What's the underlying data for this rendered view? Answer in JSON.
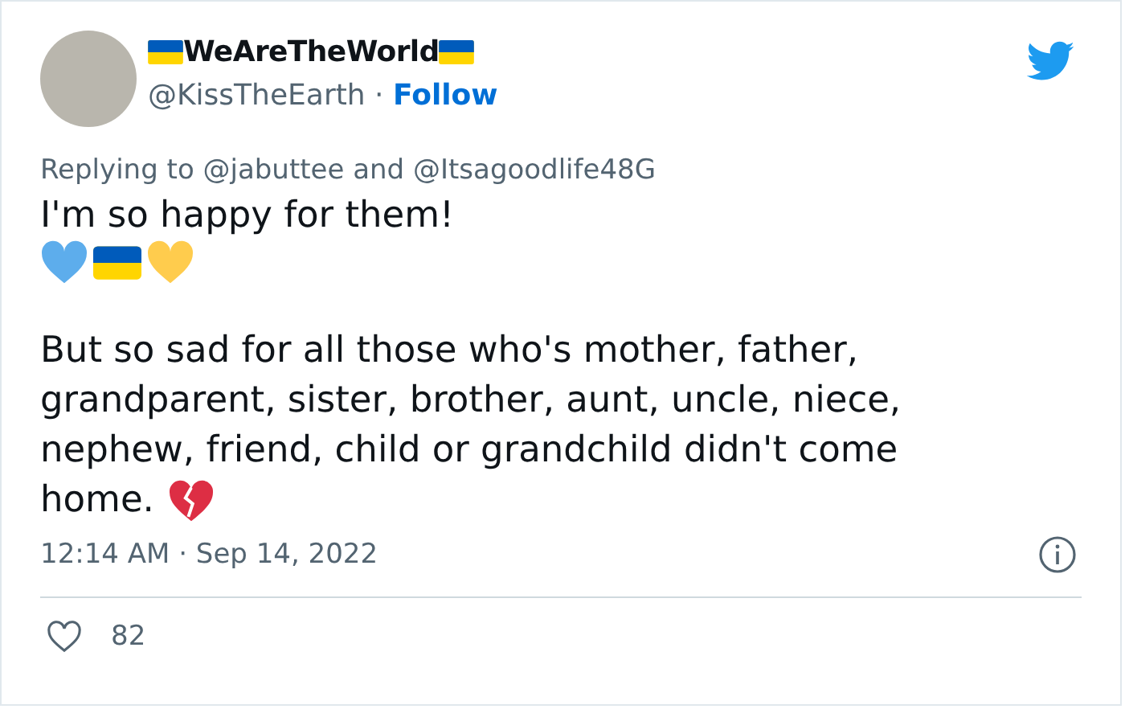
{
  "author": {
    "name": "WeAreTheWorld",
    "handle": "@KissTheEarth",
    "separator": "·",
    "follow": "Follow"
  },
  "reply_context": "Replying to @jabuttee and @Itsagoodlife48G",
  "body": {
    "first_line": "I'm so happy for them!",
    "paragraph_lines": [
      "But so sad for all those who's mother, father,",
      "grandparent, sister, brother, aunt, uncle, niece,",
      "nephew, friend, child or grandchild didn't come",
      "home."
    ]
  },
  "timestamp": "12:14 AM · Sep 14, 2022",
  "likes": {
    "count": "82"
  }
}
